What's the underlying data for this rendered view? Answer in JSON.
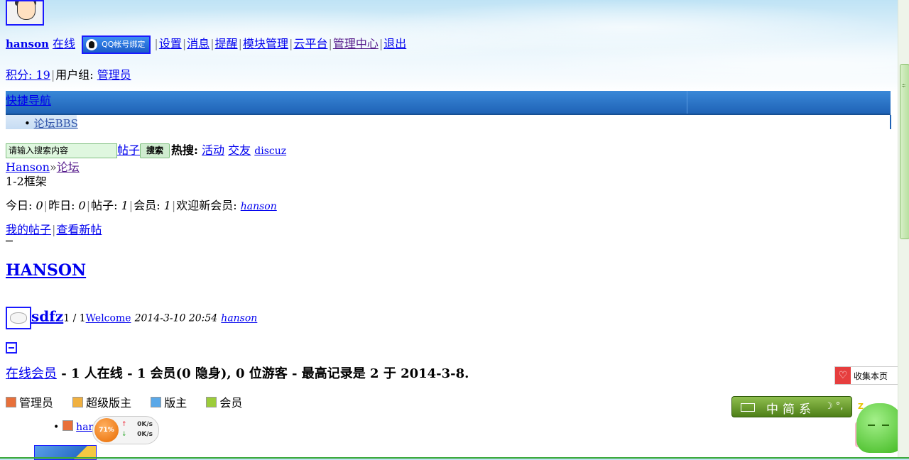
{
  "userbar": {
    "username": "hanson",
    "status": "在线",
    "qq_bind": "QQ帐号绑定",
    "links": [
      "设置",
      "消息",
      "提醒",
      "模块管理",
      "云平台",
      "管理中心",
      "退出"
    ]
  },
  "credits": {
    "label": "积分: 19",
    "group_label": "用户组: ",
    "group": "管理员"
  },
  "nav": {
    "quick_nav": "快捷导航",
    "bbs": "论坛BBS"
  },
  "search": {
    "placeholder": "请输入搜索内容",
    "scope": "帖子",
    "button": "搜索",
    "hot_label": "热搜:",
    "hot": [
      "活动",
      "交友",
      "discuz"
    ]
  },
  "breadcrumb": {
    "home": "Hanson",
    "sep": "»",
    "current": "论坛"
  },
  "frame_label": "1-2框架",
  "stats": {
    "today_label": "今日: ",
    "today": "0",
    "yesterday_label": "昨日: ",
    "yesterday": "0",
    "posts_label": "帖子: ",
    "posts": "1",
    "members_label": "会员: ",
    "members": "1",
    "welcome_label": "欢迎新会员: ",
    "newest": "hanson"
  },
  "mylinks": {
    "my_posts": "我的帖子",
    "new_posts": "查看新帖"
  },
  "section_title": "HANSON",
  "forum": {
    "name": "sdfz",
    "counts": "1 / 1",
    "last_title": "Welcome",
    "last_time": "2014-3-10 20:54",
    "last_user": "hanson"
  },
  "online": {
    "link": "在线会员",
    "summary": "- 1 人在线 - 1 会员(0 隐身), 0 位游客 - 最高记录是 2 于 2014-3-8."
  },
  "legend": [
    {
      "label": "管理员",
      "color": "#e8703a"
    },
    {
      "label": "超级版主",
      "color": "#f0b040"
    },
    {
      "label": "版主",
      "color": "#5aa8e8"
    },
    {
      "label": "会员",
      "color": "#9ccc3a"
    }
  ],
  "online_list": {
    "item": "han"
  },
  "collect": {
    "label": "收集本页"
  },
  "ime": {
    "label": "中简系"
  },
  "netwidget": {
    "percent": "71%",
    "up": "0K/s",
    "down": "0K/s"
  }
}
